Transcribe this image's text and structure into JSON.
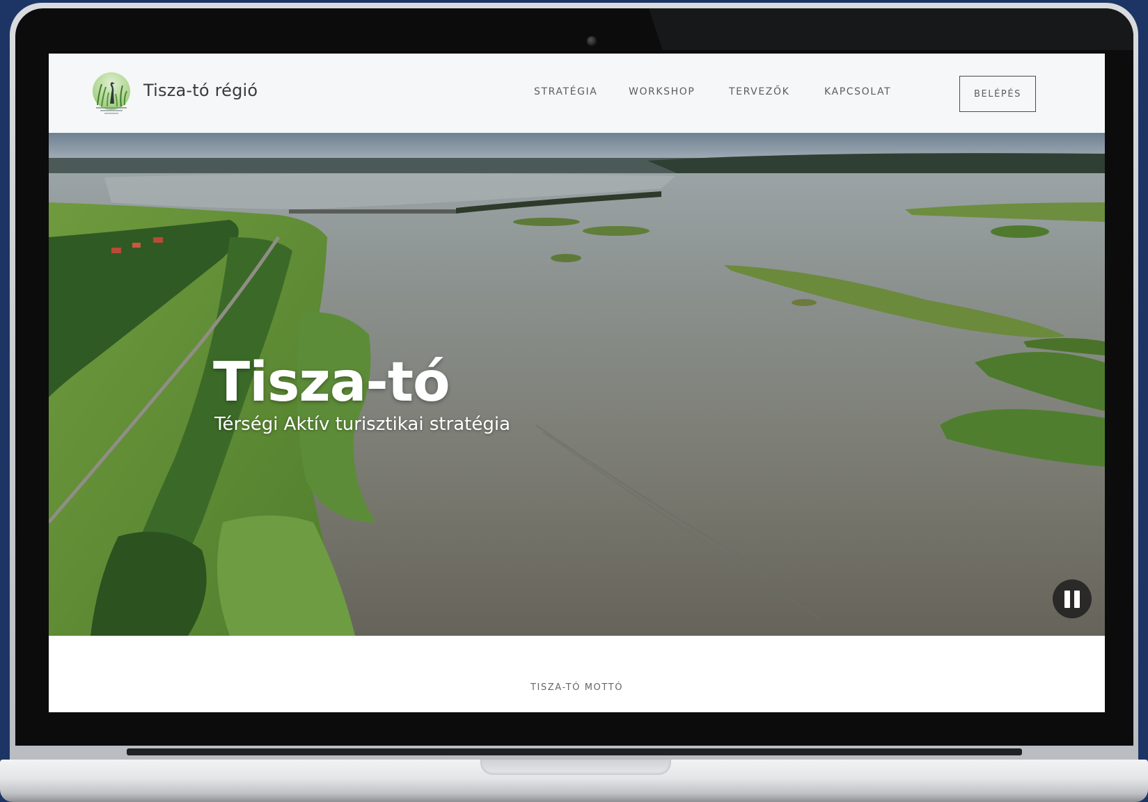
{
  "site": {
    "brand_name": "Tisza-tó régió",
    "logo_icon": "heron-reeds-logo-icon"
  },
  "nav": {
    "items": [
      {
        "label": "STRATÉGIA"
      },
      {
        "label": "WORKSHOP"
      },
      {
        "label": "TERVEZŐK"
      },
      {
        "label": "KAPCSOLAT"
      }
    ],
    "login_label": "BELÉPÉS"
  },
  "hero": {
    "title": "Tisza-tó",
    "subtitle": "Térségi Aktív turisztikai stratégia",
    "background": "aerial-lake-video",
    "video_control_icon": "pause-icon"
  },
  "section": {
    "motto_label": "TISZA-TÓ MOTTÓ"
  },
  "colors": {
    "page_background": "#1d3564",
    "header_background": "#f6f7f8",
    "nav_text": "#5c5c5c",
    "hero_text": "#ffffff"
  }
}
